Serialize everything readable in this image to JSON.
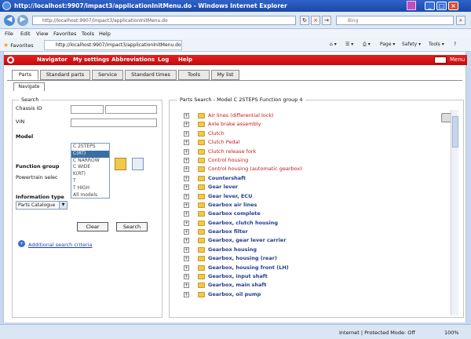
{
  "window": {
    "title": "http://localhost:9907/impact3/applicationInitMenu.do - Windows Internet Explorer"
  },
  "address": {
    "url": "http://localhost:9907/impact3/applicationInitMenu.do",
    "search_placeholder": "Bing"
  },
  "menubar": [
    "File",
    "Edit",
    "View",
    "Favorites",
    "Tools",
    "Help"
  ],
  "favorites": {
    "label": "Favorites",
    "tab": "http://localhost:9907/impact3/applicationInitMenu.do",
    "commands": [
      "Page ▾",
      "Safety ▾",
      "Tools ▾",
      "?"
    ]
  },
  "nav": {
    "items": [
      "Navigator",
      "My settings",
      "Abbreviations",
      "Log",
      "Help"
    ],
    "menu": "Menu"
  },
  "tabs": [
    "Parts",
    "Standard parts",
    "Service",
    "Standard times",
    "Tools",
    "My list"
  ],
  "subtab": "Navigate",
  "search": {
    "legend": "Search",
    "chassis_label": "Chassis ID",
    "vin_label": "VIN",
    "model_label": "Model",
    "model_options": [
      "C 2STEPS",
      "C(RT)",
      "C NARROW",
      "C WIDE",
      "K(RT)",
      "T",
      "T HIGH",
      "All models"
    ],
    "model_selected_index": 1,
    "function_group_label": "Function group",
    "powertrain_label": "Powertrain selec",
    "info_type_label": "Information type",
    "info_type_value": "Parts Catalogue",
    "clear_label": "Clear",
    "search_label": "Search",
    "additional_link": "Additional search criteria"
  },
  "tree": {
    "legend": "Parts Search - Model C 2STEPS Function group 4",
    "items": [
      {
        "name": "Air lines (differential lock)",
        "style": "red"
      },
      {
        "name": "Axle brake assembly",
        "style": "red"
      },
      {
        "name": "Clutch",
        "style": "red"
      },
      {
        "name": "Clutch Pedal",
        "style": "red"
      },
      {
        "name": "Clutch release fork",
        "style": "red"
      },
      {
        "name": "Control housing",
        "style": "red"
      },
      {
        "name": "Control housing (automatic gearbox)",
        "style": "red"
      },
      {
        "name": "Countershaft",
        "style": "blue"
      },
      {
        "name": "Gear lever",
        "style": "blue"
      },
      {
        "name": "Gear lever, ECU",
        "style": "blue"
      },
      {
        "name": "Gearbox air lines",
        "style": "blue"
      },
      {
        "name": "Gearbox complete",
        "style": "blue"
      },
      {
        "name": "Gearbox, clutch housing",
        "style": "blue"
      },
      {
        "name": "Gearbox filter",
        "style": "blue"
      },
      {
        "name": "Gearbox, gear lever carrier",
        "style": "blue"
      },
      {
        "name": "Gearbox housing",
        "style": "blue"
      },
      {
        "name": "Gearbox, housing (rear)",
        "style": "blue"
      },
      {
        "name": "Gearbox, housing front (LH)",
        "style": "blue"
      },
      {
        "name": "Gearbox, input shaft",
        "style": "blue"
      },
      {
        "name": "Gearbox, main shaft",
        "style": "blue"
      },
      {
        "name": "Gearbox, oil pump",
        "style": "blue"
      }
    ]
  },
  "status": {
    "zone": "Internet | Protected Mode: Off",
    "zoom": "100%"
  }
}
